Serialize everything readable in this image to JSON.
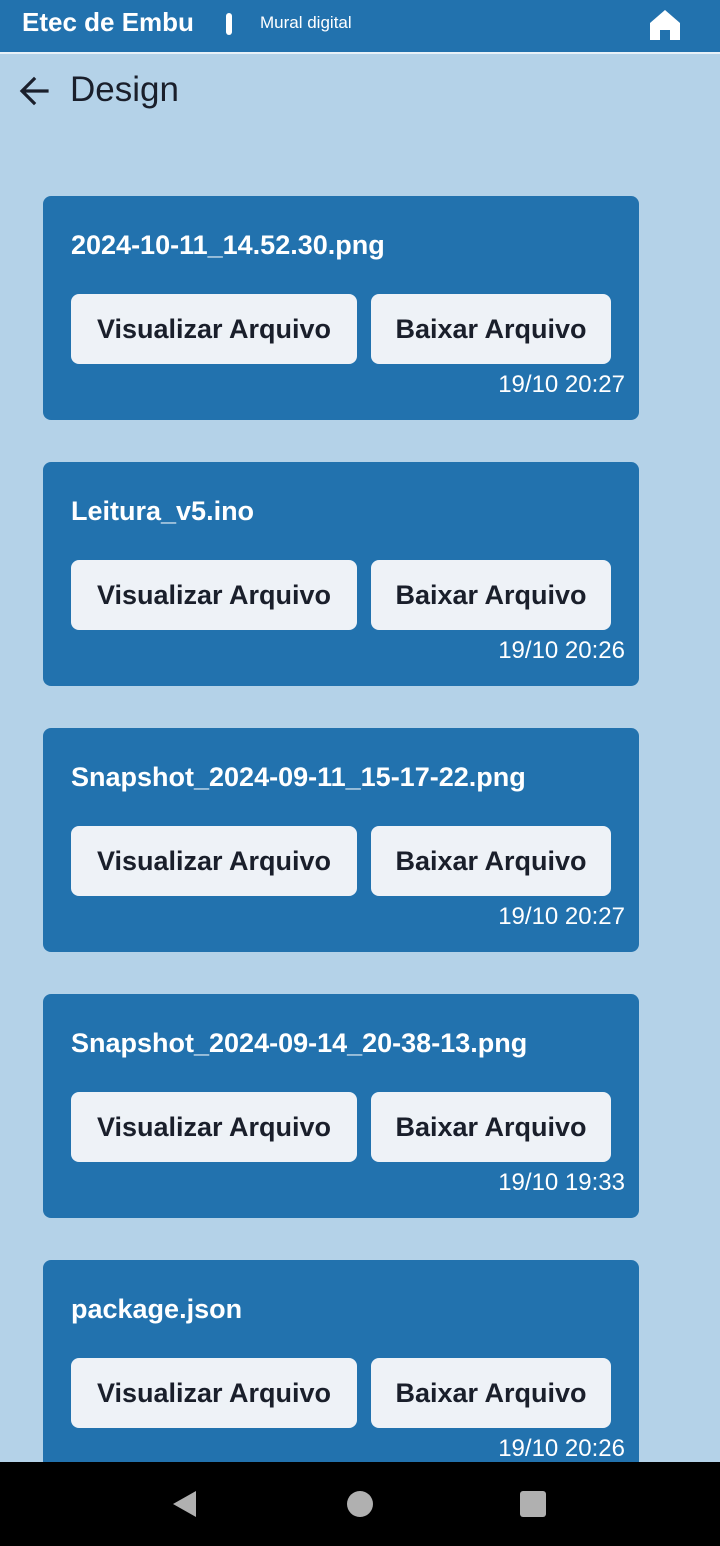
{
  "header": {
    "app_name": "Etec de Embu",
    "subtitle": "Mural digital",
    "home_icon": "home-icon"
  },
  "page": {
    "back_icon": "arrow-left-icon",
    "title": "Design"
  },
  "files": [
    {
      "name": "2024-10-11_14.52.30.png",
      "view_label": "Visualizar Arquivo",
      "download_label": "Baixar Arquivo",
      "time": "19/10 20:27"
    },
    {
      "name": "Leitura_v5.ino",
      "view_label": "Visualizar Arquivo",
      "download_label": "Baixar Arquivo",
      "time": "19/10 20:26"
    },
    {
      "name": "Snapshot_2024-09-11_15-17-22.png",
      "view_label": "Visualizar Arquivo",
      "download_label": "Baixar Arquivo",
      "time": "19/10 20:27"
    },
    {
      "name": "Snapshot_2024-09-14_20-38-13.png",
      "view_label": "Visualizar Arquivo",
      "download_label": "Baixar Arquivo",
      "time": "19/10 19:33"
    },
    {
      "name": "package.json",
      "view_label": "Visualizar Arquivo",
      "download_label": "Baixar Arquivo",
      "time": "19/10 20:26"
    }
  ],
  "navbar": {
    "back_icon": "triangle-back-icon",
    "home_icon": "circle-home-icon",
    "recents_icon": "square-recents-icon"
  },
  "colors": {
    "primary": "#2272ae",
    "background": "#b4d2e8",
    "button_bg": "#eef2f7",
    "text_dark": "#1a1f2b"
  }
}
